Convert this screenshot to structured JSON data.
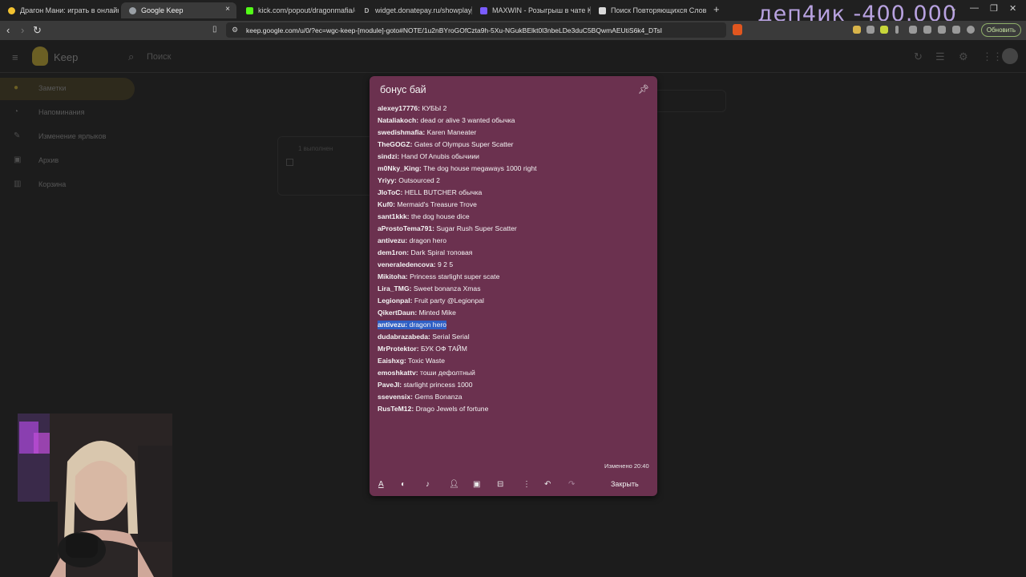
{
  "browser": {
    "tabs": [
      {
        "label": "Драгон Мани: играть в онлайн казі",
        "icon_color": "#f2c230"
      },
      {
        "label": "Google Keep",
        "icon_color": "#f2c230",
        "active": true
      },
      {
        "label": "kick.com/popout/dragonmafia/chat",
        "icon_color": "#53fc18"
      },
      {
        "label": "widget.donatepay.ru/showplayer",
        "icon_color": "#3a7bd5",
        "icon_text": "D"
      },
      {
        "label": "MAXWIN - Розыгрыш в чате Kick",
        "icon_color": "#7a5cff"
      },
      {
        "label": "Поиск Повторяющихся Слов",
        "icon_color": "#d9d9d9"
      }
    ],
    "tab_close": "×",
    "new_tab": "+",
    "url": "keep.google.com/u/0/?ec=wgc-keep-[module]-goto#NOTE/1u2nBYroGOfCzta9h-5Xu-NGukBElkt0l3nbeLDe3duC5BQwmAEUtiS6k4_DTsI",
    "update_button": "Обновить",
    "overlay_text": "деп4ик -400.000"
  },
  "keep": {
    "app_title": "Keep",
    "search_placeholder": "Поиск",
    "sidebar": [
      {
        "label": "Заметки",
        "icon": "bulb-icon",
        "active": true
      },
      {
        "label": "Напоминания",
        "icon": "bell-icon"
      },
      {
        "label": "Изменение ярлыков",
        "icon": "pencil-icon"
      },
      {
        "label": "Архив",
        "icon": "archive-icon"
      },
      {
        "label": "Корзина",
        "icon": "trash-icon"
      }
    ],
    "ghost_card_text": "1 выполнен"
  },
  "note": {
    "title": "бонус бай",
    "entries": [
      {
        "user": "alexey17776:",
        "text": " КУБЫ 2"
      },
      {
        "user": "Nataliakoch:",
        "text": " dead or alive 3 wanted обычка"
      },
      {
        "user": "swedishmafia:",
        "text": " Karen Maneater"
      },
      {
        "user": "TheGOGZ:",
        "text": " Gates of Olympus Super Scatter"
      },
      {
        "user": "sindzi:",
        "text": " Hand Of Anubis обычиии"
      },
      {
        "user": "m0Nky_King:",
        "text": " The dog house megaways 1000 right"
      },
      {
        "user": "Yriyy:",
        "text": " Outsourced 2"
      },
      {
        "user": "JIoToC:",
        "text": " HELL BUTCHER обычка"
      },
      {
        "user": "Kuf0:",
        "text": " Mermaid's Treasure Trove"
      },
      {
        "user": "sant1kkk:",
        "text": " the dog house dice"
      },
      {
        "user": "aProstoTema791:",
        "text": " Sugar Rush Super Scatter"
      },
      {
        "user": "antivezu:",
        "text": " dragon hero"
      },
      {
        "user": "dem1ron:",
        "text": " Dark Spiral топовая"
      },
      {
        "user": "veneraledencova:",
        "text": " 9 2 5"
      },
      {
        "user": "Mikitoha:",
        "text": " Princess starlight super scate"
      },
      {
        "user": "Lira_TMG:",
        "text": " Sweet bonanza Xmas"
      },
      {
        "user": "Legionpal:",
        "text": " Fruit party @Legionpal"
      },
      {
        "user": "QikertDaun:",
        "text": " Minted Mike"
      },
      {
        "user": "antivezu:",
        "text": " dragon hero",
        "selected": true
      },
      {
        "user": "dudabrazabeda:",
        "text": " Serial Serial"
      },
      {
        "user": "MrProtektor:",
        "text": " БУК ОФ ТАЙМ"
      },
      {
        "user": "Eaishxg:",
        "text": " Toxic Waste"
      },
      {
        "user": "emoshkattv:",
        "text": " тоши дефолтный"
      },
      {
        "user": "PaveJI:",
        "text": " starlight princess 1000"
      },
      {
        "user": "ssevensix:",
        "text": " Gems Bonanza"
      },
      {
        "user": "RusTeM12:",
        "text": " Drago Jewels of fortune"
      }
    ],
    "edited": "Изменено 20:40",
    "close_label": "Закрыть",
    "background": "#6b314f",
    "selection_color": "#2f5fc5"
  }
}
